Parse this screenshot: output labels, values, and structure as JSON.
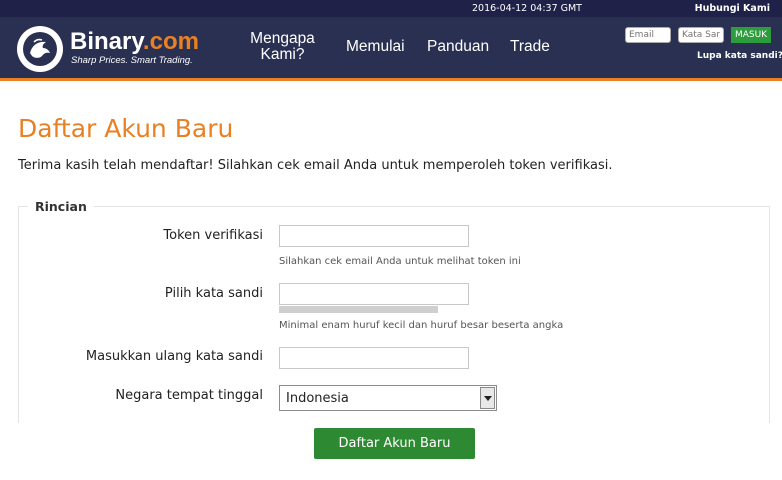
{
  "topbar": {
    "datetime": "2016-04-12 04:37 GMT",
    "contact": "Hubungi Kami"
  },
  "brand": {
    "name_main": "Binary",
    "name_suffix": ".com",
    "tagline": "Sharp Prices. Smart Trading.",
    "accent_color": "#e98024",
    "header_color": "#2a3052"
  },
  "nav": {
    "why": "Mengapa Kami?",
    "start": "Memulai",
    "guide": "Panduan",
    "trade": "Trade"
  },
  "login": {
    "email_placeholder": "Email",
    "password_placeholder": "Kata Sandi",
    "submit": "MASUK",
    "forgot": "Lupa kata sandi?"
  },
  "page": {
    "title": "Daftar Akun Baru",
    "intro": "Terima kasih telah mendaftar! Silahkan cek email Anda untuk memperoleh token verifikasi."
  },
  "form": {
    "legend": "Rincian",
    "token_label": "Token verifikasi",
    "token_value": "",
    "token_hint": "Silahkan cek email Anda untuk melihat token ini",
    "password_label": "Pilih kata sandi",
    "password_value": "",
    "password_hint": "Minimal enam huruf kecil dan huruf besar beserta angka",
    "repassword_label": "Masukkan ulang kata sandi",
    "repassword_value": "",
    "country_label": "Negara tempat tinggal",
    "country_value": "Indonesia",
    "submit": "Daftar Akun Baru",
    "submit_color": "#2d8a33"
  }
}
